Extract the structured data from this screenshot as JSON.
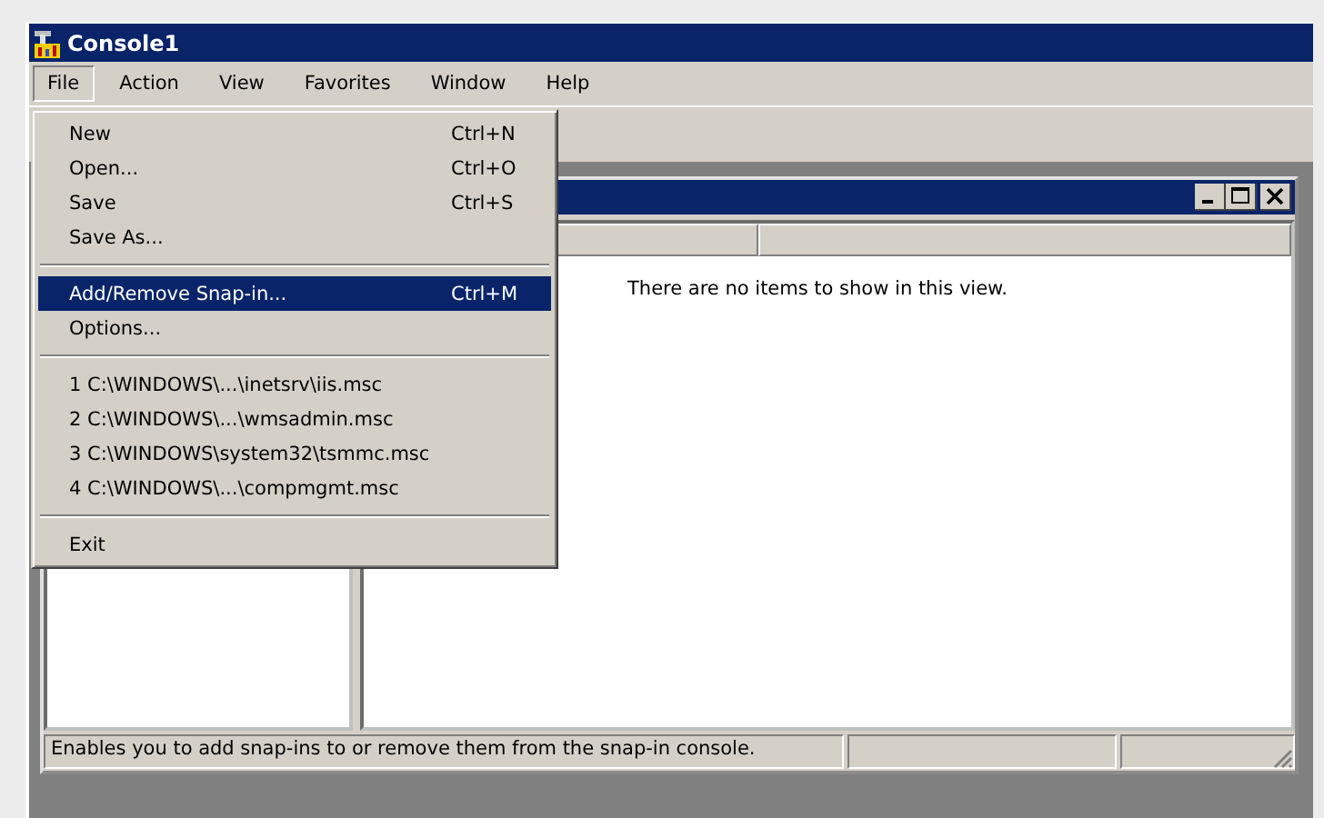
{
  "window": {
    "title": "Console1"
  },
  "menu_bar": [
    {
      "label": "File",
      "selected": true
    },
    {
      "label": "Action",
      "selected": false
    },
    {
      "label": "View",
      "selected": false
    },
    {
      "label": "Favorites",
      "selected": false
    },
    {
      "label": "Window",
      "selected": false
    },
    {
      "label": "Help",
      "selected": false
    }
  ],
  "file_menu": [
    {
      "kind": "item",
      "label": "New",
      "shortcut": "Ctrl+N",
      "selected": false
    },
    {
      "kind": "item",
      "label": "Open...",
      "shortcut": "Ctrl+O",
      "selected": false
    },
    {
      "kind": "item",
      "label": "Save",
      "shortcut": "Ctrl+S",
      "selected": false
    },
    {
      "kind": "item",
      "label": "Save  As...",
      "selected": false
    },
    {
      "kind": "separator"
    },
    {
      "kind": "item",
      "label": "Add/Remove Snap-in...",
      "shortcut": "Ctrl+M",
      "selected": true
    },
    {
      "kind": "item",
      "label": "Options...",
      "selected": false
    },
    {
      "kind": "separator"
    },
    {
      "kind": "item",
      "label": "1 C:\\WINDOWS\\...\\inetsrv\\iis.msc",
      "selected": false
    },
    {
      "kind": "item",
      "label": "2 C:\\WINDOWS\\...\\wmsadmin.msc",
      "selected": false
    },
    {
      "kind": "item",
      "label": "3 C:\\WINDOWS\\system32\\tsmmc.msc",
      "selected": false
    },
    {
      "kind": "item",
      "label": "4 C:\\WINDOWS\\...\\compmgmt.msc",
      "selected": false
    },
    {
      "kind": "separator"
    },
    {
      "kind": "item",
      "label": "Exit",
      "selected": false
    }
  ],
  "child_window": {
    "empty_message": "There are no items to show in this view."
  },
  "status_bar": {
    "text": "Enables you to add snap-ins to or remove them from the snap-in console."
  }
}
